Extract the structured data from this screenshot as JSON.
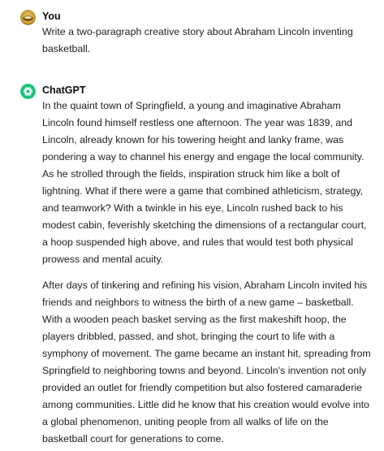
{
  "conversation": {
    "user": {
      "name": "You",
      "avatar_icon": "user-photo-avatar",
      "message": "Write a two-paragraph creative story about Abraham Lincoln inventing basketball."
    },
    "assistant": {
      "name": "ChatGPT",
      "avatar_icon": "openai-logo-icon",
      "accent_color": "#19c37d",
      "paragraphs": [
        "In the quaint town of Springfield, a young and imaginative Abraham Lincoln found himself restless one afternoon. The year was 1839, and Lincoln, already known for his towering height and lanky frame, was pondering a way to channel his energy and engage the local community. As he strolled through the fields, inspiration struck him like a bolt of lightning. What if there were a game that combined athleticism, strategy, and teamwork? With a twinkle in his eye, Lincoln rushed back to his modest cabin, feverishly sketching the dimensions of a rectangular court, a hoop suspended high above, and rules that would test both physical prowess and mental acuity.",
        "After days of tinkering and refining his vision, Abraham Lincoln invited his friends and neighbors to witness the birth of a new game – basketball. With a wooden peach basket serving as the first makeshift hoop, the players dribbled, passed, and shot, bringing the court to life with a symphony of movement. The game became an instant hit, spreading from Springfield to neighboring towns and beyond. Lincoln's invention not only provided an outlet for friendly competition but also fostered camaraderie among communities. Little did he know that his creation would evolve into a global phenomenon, uniting people from all walks of life on the basketball court for generations to come."
      ]
    }
  }
}
